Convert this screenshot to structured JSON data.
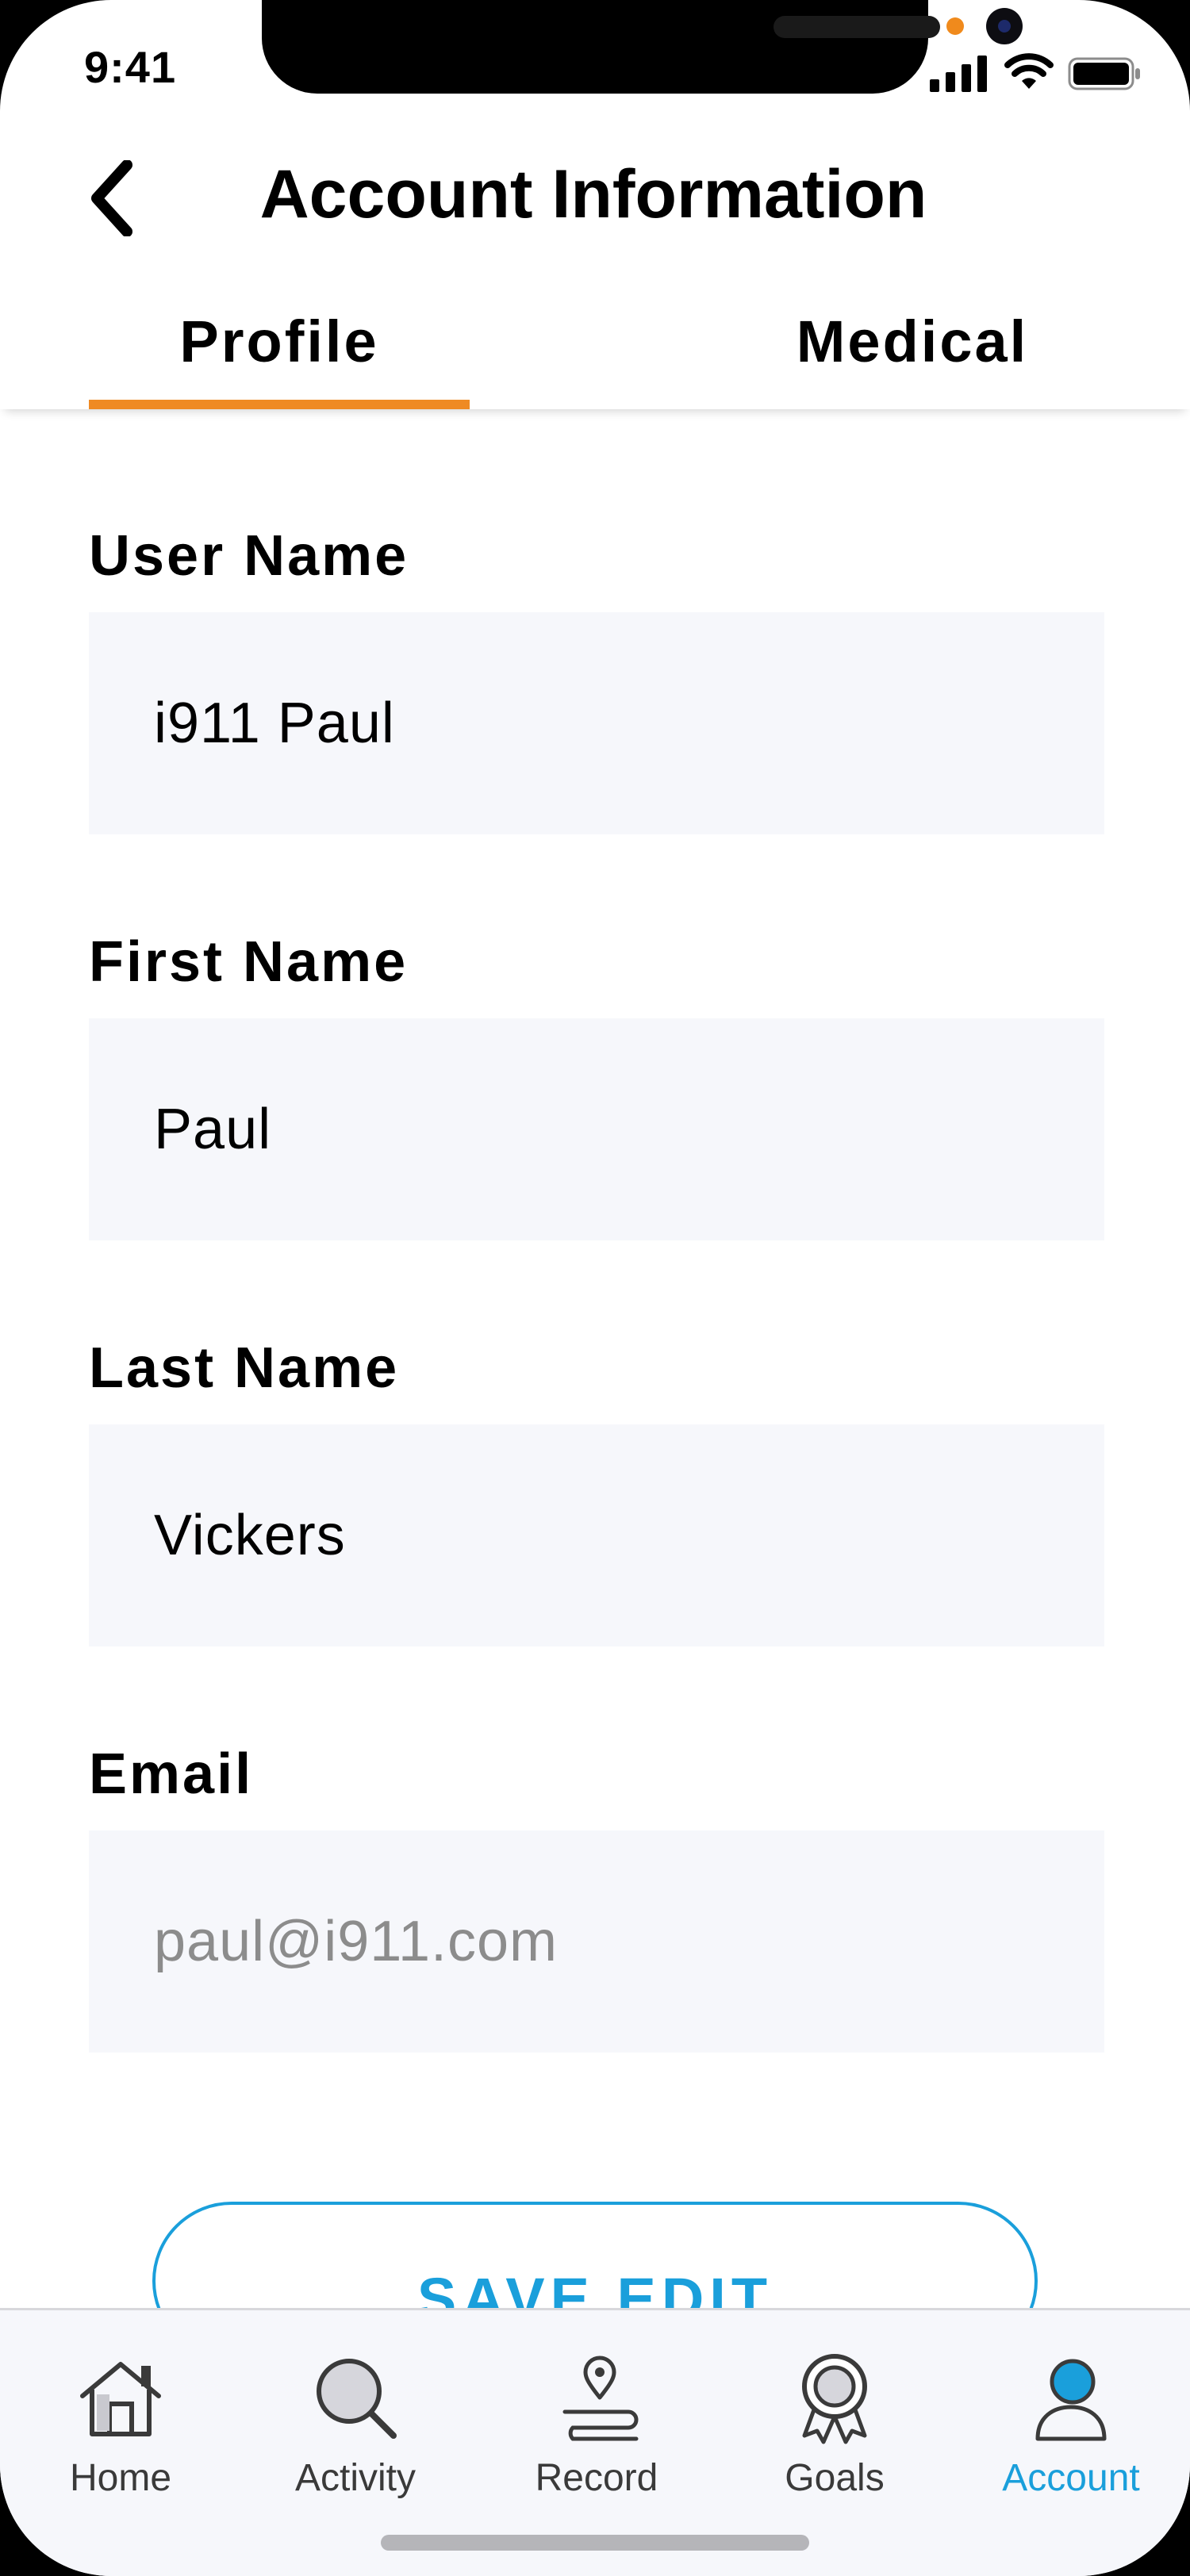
{
  "status_bar": {
    "time": "9:41"
  },
  "header": {
    "title": "Account Information"
  },
  "tabs": [
    {
      "label": "Profile",
      "selected": true
    },
    {
      "label": "Medical",
      "selected": false
    }
  ],
  "form": {
    "username": {
      "label": "User Name",
      "value": "i911 Paul"
    },
    "first_name": {
      "label": "First Name",
      "value": "Paul"
    },
    "last_name": {
      "label": "Last Name",
      "value": "Vickers"
    },
    "email": {
      "label": "Email",
      "value": "paul@i911.com"
    }
  },
  "save_button": {
    "label": "SAVE EDIT"
  },
  "nav": {
    "items": [
      {
        "label": "Home",
        "icon": "home-icon"
      },
      {
        "label": "Activity",
        "icon": "search-icon"
      },
      {
        "label": "Record",
        "icon": "map-pin-route-icon"
      },
      {
        "label": "Goals",
        "icon": "award-icon"
      },
      {
        "label": "Account",
        "icon": "user-icon",
        "active": true
      }
    ]
  },
  "colors": {
    "accent_orange": "#ef8a23",
    "accent_blue": "#1a9fdb",
    "field_background": "#f6f7fb",
    "muted_text": "#8c8c8c"
  }
}
